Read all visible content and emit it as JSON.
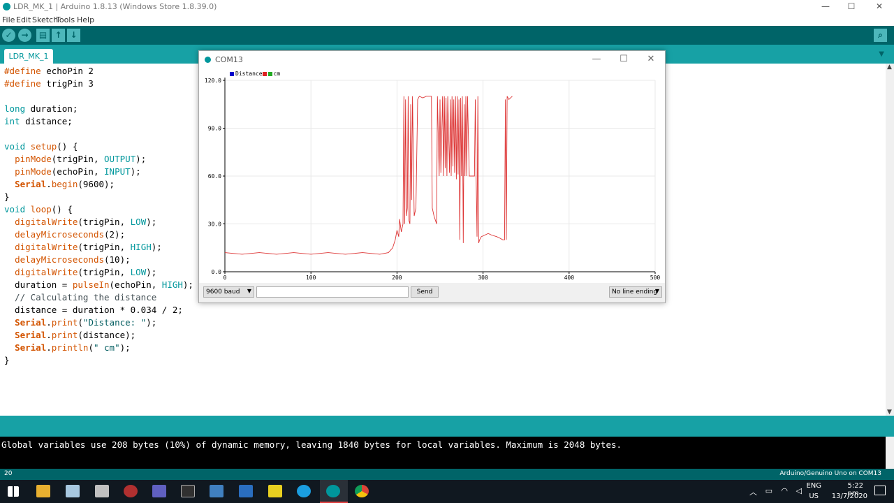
{
  "window": {
    "title": "LDR_MK_1 | Arduino 1.8.13 (Windows Store 1.8.39.0)",
    "minimize": "—",
    "maximize": "☐",
    "close": "✕"
  },
  "menu": [
    "File",
    "Edit",
    "Sketch",
    "Tools",
    "Help"
  ],
  "toolbar": {
    "verify": "✓",
    "upload": "→",
    "new": "▤",
    "open": "↑",
    "save": "↓",
    "monitor": "⌕"
  },
  "tab": {
    "label": "LDR_MK_1",
    "menu_icon": "▼"
  },
  "code": [
    [
      {
        "t": "#define",
        "c": "kw-orange"
      },
      {
        "t": " echoPin 2"
      }
    ],
    [
      {
        "t": "#define",
        "c": "kw-orange"
      },
      {
        "t": " trigPin 3"
      }
    ],
    [],
    [
      {
        "t": "long",
        "c": "kw-teal"
      },
      {
        "t": " duration;"
      }
    ],
    [
      {
        "t": "int",
        "c": "kw-teal"
      },
      {
        "t": " distance;"
      }
    ],
    [],
    [
      {
        "t": "void",
        "c": "kw-teal"
      },
      {
        "t": " "
      },
      {
        "t": "setup",
        "c": "kw-orange"
      },
      {
        "t": "() {"
      }
    ],
    [
      {
        "t": "  "
      },
      {
        "t": "pinMode",
        "c": "kw-orange"
      },
      {
        "t": "(trigPin, "
      },
      {
        "t": "OUTPUT",
        "c": "kw-teal"
      },
      {
        "t": ");"
      }
    ],
    [
      {
        "t": "  "
      },
      {
        "t": "pinMode",
        "c": "kw-orange"
      },
      {
        "t": "(echoPin, "
      },
      {
        "t": "INPUT",
        "c": "kw-teal"
      },
      {
        "t": ");"
      }
    ],
    [
      {
        "t": "  "
      },
      {
        "t": "Serial",
        "c": "kw-bold"
      },
      {
        "t": "."
      },
      {
        "t": "begin",
        "c": "kw-orange"
      },
      {
        "t": "(9600);"
      }
    ],
    [
      {
        "t": "}"
      }
    ],
    [
      {
        "t": "void",
        "c": "kw-teal"
      },
      {
        "t": " "
      },
      {
        "t": "loop",
        "c": "kw-orange"
      },
      {
        "t": "() {"
      }
    ],
    [
      {
        "t": "  "
      },
      {
        "t": "digitalWrite",
        "c": "kw-orange"
      },
      {
        "t": "(trigPin, "
      },
      {
        "t": "LOW",
        "c": "kw-teal"
      },
      {
        "t": ");"
      }
    ],
    [
      {
        "t": "  "
      },
      {
        "t": "delayMicroseconds",
        "c": "kw-orange"
      },
      {
        "t": "(2);"
      }
    ],
    [
      {
        "t": "  "
      },
      {
        "t": "digitalWrite",
        "c": "kw-orange"
      },
      {
        "t": "(trigPin, "
      },
      {
        "t": "HIGH",
        "c": "kw-teal"
      },
      {
        "t": ");"
      }
    ],
    [
      {
        "t": "  "
      },
      {
        "t": "delayMicroseconds",
        "c": "kw-orange"
      },
      {
        "t": "(10);"
      }
    ],
    [
      {
        "t": "  "
      },
      {
        "t": "digitalWrite",
        "c": "kw-orange"
      },
      {
        "t": "(trigPin, "
      },
      {
        "t": "LOW",
        "c": "kw-teal"
      },
      {
        "t": ");"
      }
    ],
    [
      {
        "t": "  duration = "
      },
      {
        "t": "pulseIn",
        "c": "kw-orange"
      },
      {
        "t": "(echoPin, "
      },
      {
        "t": "HIGH",
        "c": "kw-teal"
      },
      {
        "t": ");"
      }
    ],
    [
      {
        "t": "  // Calculating the distance",
        "c": "cmt"
      }
    ],
    [
      {
        "t": "  distance = duration * 0.034 / 2;"
      }
    ],
    [
      {
        "t": "  "
      },
      {
        "t": "Serial",
        "c": "kw-bold"
      },
      {
        "t": "."
      },
      {
        "t": "print",
        "c": "kw-orange"
      },
      {
        "t": "("
      },
      {
        "t": "\"Distance: \"",
        "c": "str"
      },
      {
        "t": ");"
      }
    ],
    [
      {
        "t": "  "
      },
      {
        "t": "Serial",
        "c": "kw-bold"
      },
      {
        "t": "."
      },
      {
        "t": "print",
        "c": "kw-orange"
      },
      {
        "t": "(distance);"
      }
    ],
    [
      {
        "t": "  "
      },
      {
        "t": "Serial",
        "c": "kw-bold"
      },
      {
        "t": "."
      },
      {
        "t": "println",
        "c": "kw-orange"
      },
      {
        "t": "("
      },
      {
        "t": "\" cm\"",
        "c": "str"
      },
      {
        "t": ");"
      }
    ],
    [
      {
        "t": "}"
      }
    ]
  ],
  "console": {
    "message": "Global variables use 208 bytes (10%) of dynamic memory, leaving 1840 bytes for local variables. Maximum is 2048 bytes."
  },
  "status": {
    "line": "20",
    "board": "Arduino/Genuino Uno on COM13"
  },
  "plotter": {
    "title": "COM13",
    "baud": "9600 baud",
    "send_label": "Send",
    "send_value": "",
    "line_ending": "No line ending",
    "minimize": "—",
    "maximize": "☐",
    "close": "✕"
  },
  "chart_data": {
    "type": "line",
    "title": "",
    "xlabel": "",
    "ylabel": "",
    "xlim": [
      0,
      500
    ],
    "ylim": [
      0,
      120
    ],
    "x_ticks": [
      "0",
      "100",
      "200",
      "300",
      "400",
      "500"
    ],
    "y_ticks": [
      "0.0",
      "30.0",
      "60.0",
      "90.0",
      "120.0"
    ],
    "grid": true,
    "legend": [
      "Distance",
      "cm"
    ],
    "legend_colors": [
      "#0000cc",
      "#dd2222",
      "#22aa22"
    ],
    "series": [
      {
        "name": "Distance",
        "color": "#dd3333",
        "points": [
          [
            0,
            12
          ],
          [
            20,
            11
          ],
          [
            40,
            12
          ],
          [
            60,
            11
          ],
          [
            80,
            12
          ],
          [
            100,
            11
          ],
          [
            120,
            12
          ],
          [
            140,
            11
          ],
          [
            160,
            12
          ],
          [
            180,
            11
          ],
          [
            190,
            12
          ],
          [
            195,
            15
          ],
          [
            198,
            20
          ],
          [
            200,
            26
          ],
          [
            202,
            22
          ],
          [
            203,
            33
          ],
          [
            205,
            25
          ],
          [
            207,
            30
          ],
          [
            208,
            110
          ],
          [
            209,
            30
          ],
          [
            210,
            108
          ],
          [
            211,
            35
          ],
          [
            212,
            40
          ],
          [
            213,
            110
          ],
          [
            214,
            32
          ],
          [
            215,
            30
          ],
          [
            216,
            105
          ],
          [
            217,
            45
          ],
          [
            218,
            110
          ],
          [
            220,
            35
          ],
          [
            222,
            40
          ],
          [
            224,
            108
          ],
          [
            226,
            110
          ],
          [
            230,
            109
          ],
          [
            234,
            110
          ],
          [
            238,
            110
          ],
          [
            240,
            110
          ],
          [
            241,
            40
          ],
          [
            243,
            35
          ],
          [
            246,
            30
          ],
          [
            247,
            110
          ],
          [
            249,
            60
          ],
          [
            250,
            108
          ],
          [
            251,
            62
          ],
          [
            253,
            110
          ],
          [
            254,
            60
          ],
          [
            255,
            110
          ],
          [
            256,
            65
          ],
          [
            257,
            109
          ],
          [
            258,
            60
          ],
          [
            259,
            110
          ],
          [
            261,
            62
          ],
          [
            262,
            108
          ],
          [
            263,
            60
          ],
          [
            264,
            110
          ],
          [
            265,
            66
          ],
          [
            266,
            108
          ],
          [
            267,
            62
          ],
          [
            268,
            110
          ],
          [
            269,
            58
          ],
          [
            270,
            110
          ],
          [
            271,
            61
          ],
          [
            272,
            108
          ],
          [
            273,
            20
          ],
          [
            274,
            109
          ],
          [
            275,
            60
          ],
          [
            276,
            110
          ],
          [
            277,
            18
          ],
          [
            278,
            105
          ],
          [
            279,
            60
          ],
          [
            280,
            110
          ],
          [
            281,
            60
          ],
          [
            282,
            110
          ],
          [
            284,
            60
          ],
          [
            286,
            60
          ],
          [
            288,
            60
          ],
          [
            290,
            60
          ],
          [
            291,
            108
          ],
          [
            292,
            60
          ],
          [
            293,
            22
          ],
          [
            294,
            110
          ],
          [
            295,
            18
          ],
          [
            296,
            20
          ],
          [
            298,
            22
          ],
          [
            302,
            23
          ],
          [
            306,
            24
          ],
          [
            310,
            23
          ],
          [
            316,
            22
          ],
          [
            320,
            21
          ],
          [
            323,
            20
          ],
          [
            325,
            20
          ],
          [
            326,
            108
          ],
          [
            327,
            20
          ],
          [
            328,
            110
          ],
          [
            330,
            108
          ],
          [
            332,
            109
          ],
          [
            334,
            110
          ]
        ]
      }
    ]
  },
  "taskbar": {
    "lang1": "ENG",
    "lang2": "US",
    "time": "5:22 pm",
    "date": "13/7/2020"
  }
}
